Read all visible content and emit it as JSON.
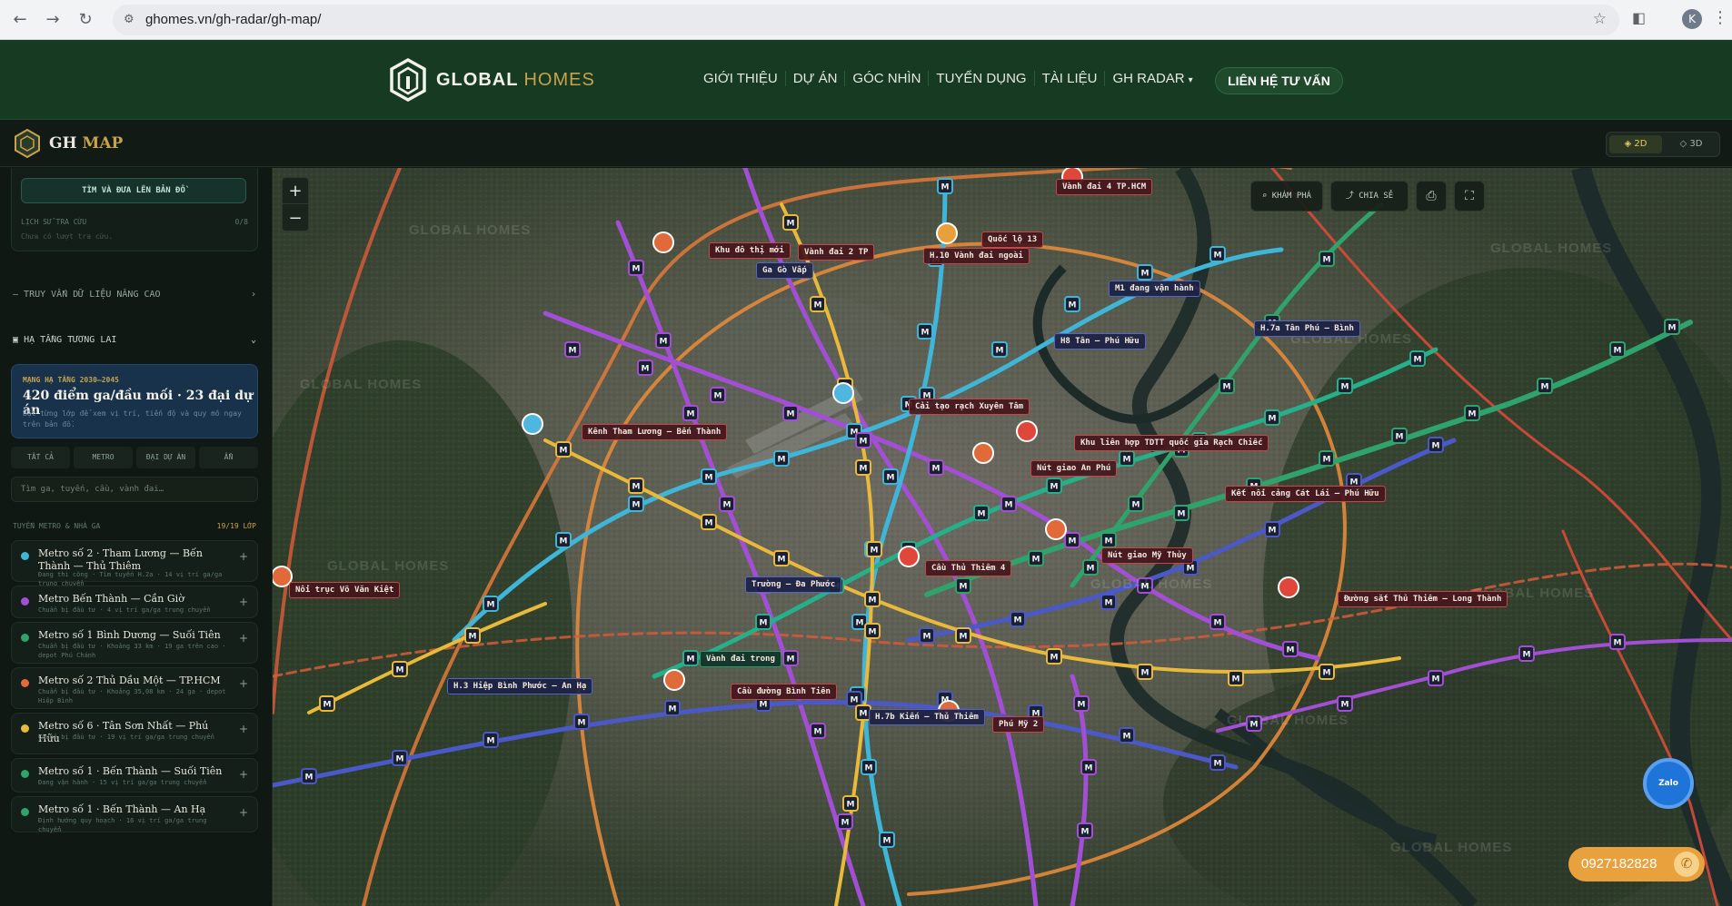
{
  "browser": {
    "url": "ghomes.vn/gh-radar/gh-map/",
    "profile_initial": "K"
  },
  "header": {
    "brand_word1": "GLOBAL",
    "brand_word2": "HOMES",
    "nav": [
      {
        "label": "GIỚI THIỆU"
      },
      {
        "label": "DỰ ÁN"
      },
      {
        "label": "GÓC NHÌN"
      },
      {
        "label": "TUYỂN DỤNG"
      },
      {
        "label": "TÀI LIỆU"
      },
      {
        "label": "GH RADAR"
      }
    ],
    "cta": "LIÊN HỆ TƯ VẤN"
  },
  "mapbar": {
    "title_a": "GH",
    "title_b": "MAP",
    "view_2d": "2D",
    "view_3d": "3D"
  },
  "sidebar": {
    "find_button": "TÌM VÀ ĐƯA LÊN BẢN ĐỒ",
    "history_label": "LỊCH SỬ TRA CỨU",
    "history_count": "0/8",
    "history_empty": "Chưa có lượt tra cứu.",
    "advanced": "TRUY VẤN DỮ LIỆU NÂNG CAO",
    "future_infra": "HẠ TẦNG TƯƠNG LAI",
    "plan_kicker": "MẠNG HẠ TẦNG 2030–2045",
    "plan_title": "420 điểm ga/đầu mối · 23 đại dự án",
    "plan_desc": "Bật từng lớp để xem vị trí, tiến độ và quy mô ngay trên bản đồ.",
    "filters": [
      "TẤT CẢ",
      "METRO",
      "ĐẠI DỰ ÁN",
      "ẨN"
    ],
    "search_placeholder": "Tìm ga, tuyến, cầu, vành đai…",
    "routes_label": "TUYẾN METRO & NHÀ GA",
    "routes_count": "19/19 LỚP",
    "routes": [
      {
        "name": "Metro số 2 · Tham Lương — Bến Thành — Thủ Thiêm",
        "meta": "Đang thi công · Tìm tuyến H.2a · 14 vị trí ga/ga trung chuyển",
        "color": "#3fb6d8"
      },
      {
        "name": "Metro Bến Thành — Cần Giờ",
        "meta": "Chuẩn bị đầu tư · 4 vị trí ga/ga trung chuyển",
        "color": "#a24fd6"
      },
      {
        "name": "Metro số 1 Bình Dương — Suối Tiên",
        "meta": "Chuẩn bị đầu tư · Khoảng 33 km · 19 ga trên cao · depot Phú Chánh",
        "color": "#2fa36b"
      },
      {
        "name": "Metro số 2 Thủ Dầu Một — TP.HCM",
        "meta": "Chuẩn bị đầu tư · Khoảng 35,08 km · 24 ga · depot Hiệp Bình",
        "color": "#e36a3a"
      },
      {
        "name": "Metro số 6 · Tân Sơn Nhất — Phú Hữu",
        "meta": "Chuẩn bị đầu tư · 19 vị trí ga/ga trung chuyển",
        "color": "#e8b93a"
      },
      {
        "name": "Metro số 1 · Bến Thành — Suối Tiên",
        "meta": "Đang vận hành · 15 vị trí ga/ga trung chuyển",
        "color": "#2fa36b"
      },
      {
        "name": "Metro số 1 · Bến Thành — An Hạ",
        "meta": "Định hướng quy hoạch · 16 vị trí ga/ga trung chuyển",
        "color": "#2fa36b"
      }
    ]
  },
  "map": {
    "zoom_in": "+",
    "zoom_out": "−",
    "tools": {
      "explore": "KHÁM PHÁ",
      "share": "CHIA SẺ"
    },
    "watermark": "GLOBAL HOMES",
    "labels": [
      "Vành đai 4 TP.HCM",
      "Khu đô thị mới",
      "Vành đai 2 TP",
      "Ga Gò Vấp",
      "H.10 Vành đai ngoài",
      "Quốc lộ 13",
      "M1 đang vận hành",
      "H.7a Tân Phú — Bình",
      "H8 Tân — Phú Hữu",
      "Kênh Tham Lương — Bến Thành",
      "Cải tạo rạch Xuyên Tâm",
      "Khu liên hợp TDTT quốc gia Rạch Chiếc",
      "Nút giao An Phú",
      "Kết nối cảng Cát Lái — Phú Hữu",
      "Nút giao Mỹ Thủy",
      "Cầu Thủ Thiêm 4",
      "Trường — Đa Phước",
      "Nối trục Võ Văn Kiệt",
      "Đường sắt Thủ Thiêm — Long Thành",
      "Vành đai trong",
      "H.3 Hiệp Bình Phước — An Hạ",
      "Cầu đường Bình Tiên",
      "H.7b Kiến — Thủ Thiêm",
      "Phú Mỹ 2"
    ],
    "phone": "0927182828",
    "zalo": "Zalo"
  }
}
